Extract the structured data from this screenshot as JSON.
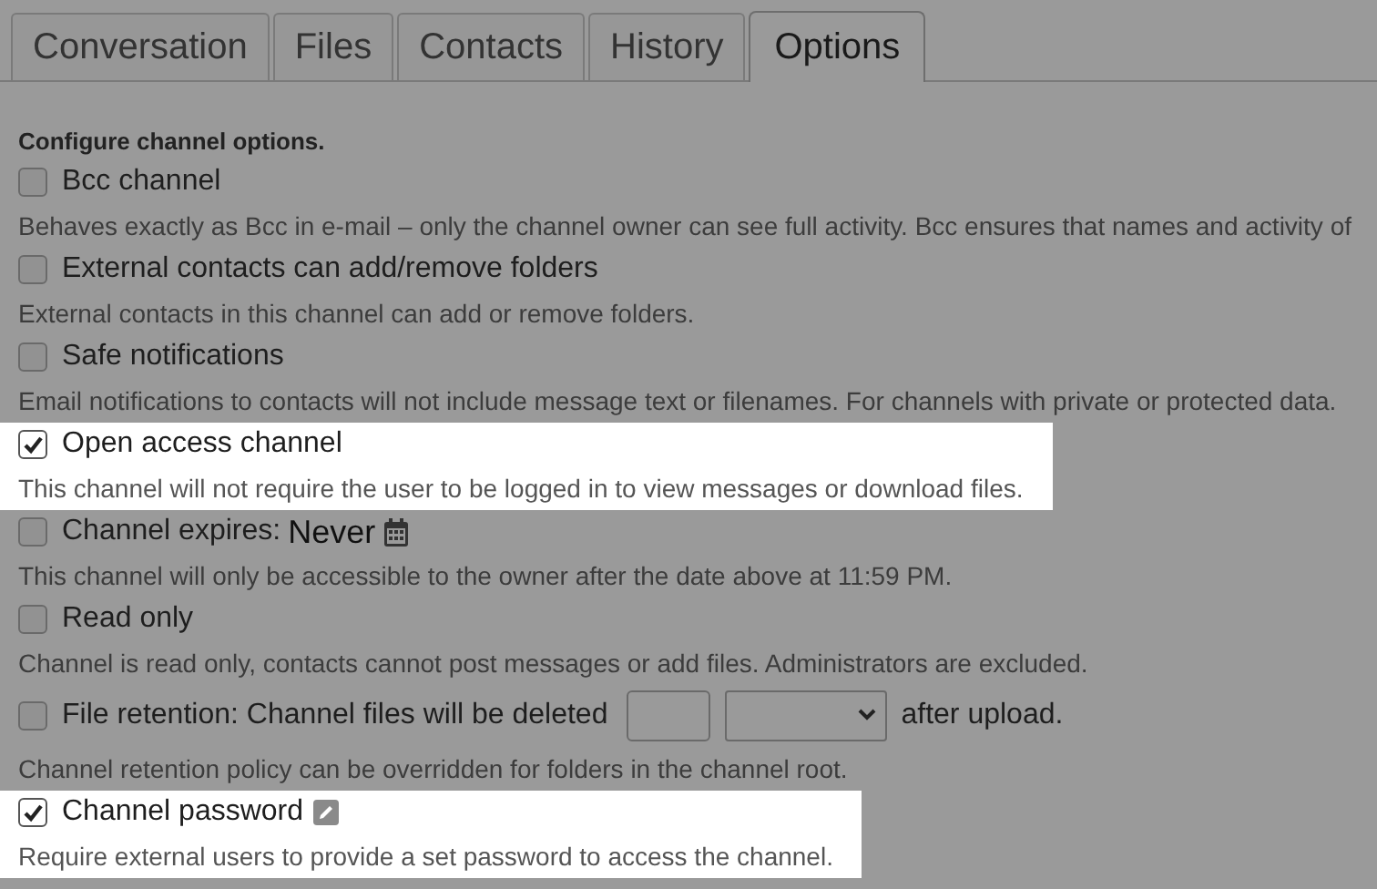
{
  "tabs": [
    {
      "label": "Conversation",
      "selected": false
    },
    {
      "label": "Files",
      "selected": false
    },
    {
      "label": "Contacts",
      "selected": false
    },
    {
      "label": "History",
      "selected": false
    },
    {
      "label": "Options",
      "selected": true
    }
  ],
  "heading": "Configure channel options.",
  "options": [
    {
      "kind": "plain",
      "label": "Bcc channel",
      "checked": false,
      "description": "Behaves exactly as Bcc in e-mail – only the channel owner can see full activity. Bcc ensures that names and activity of"
    },
    {
      "kind": "plain",
      "label": "External contacts can add/remove folders",
      "checked": false,
      "description": "External contacts in this channel can add or remove folders."
    },
    {
      "kind": "plain",
      "label": "Safe notifications",
      "checked": false,
      "description": "Email notifications to contacts will not include message text or filenames. For channels with private or protected data."
    },
    {
      "kind": "plain",
      "label": "Open access channel",
      "checked": true,
      "description": "This channel will not require the user to be logged in to view messages or download files."
    },
    {
      "kind": "expires",
      "label": "Channel expires:",
      "value": "Never",
      "checked": false,
      "description": "This channel will only be accessible to the owner after the date above at 11:59 PM."
    },
    {
      "kind": "plain",
      "label": "Read only",
      "checked": false,
      "description": "Channel is read only, contacts cannot post messages or add files. Administrators are excluded."
    },
    {
      "kind": "retention",
      "label": "File retention: Channel files will be deleted",
      "suffix": "after upload.",
      "checked": false,
      "description": "Channel retention policy can be overridden for folders in the channel root."
    },
    {
      "kind": "password",
      "label": "Channel password",
      "checked": true,
      "description": "Require external users to provide a set password to access the channel."
    }
  ]
}
